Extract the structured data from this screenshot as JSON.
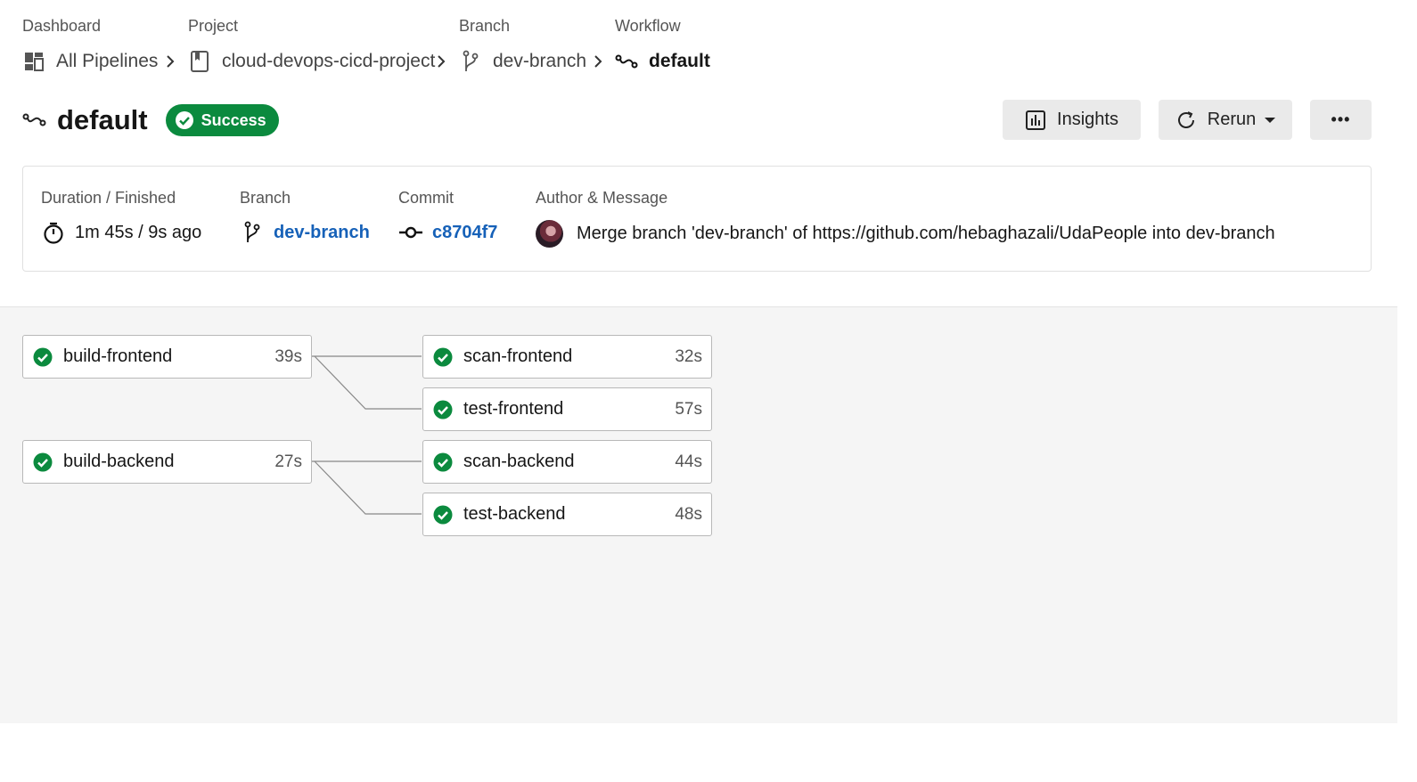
{
  "breadcrumb": {
    "dashboard": {
      "label": "Dashboard",
      "value": "All Pipelines"
    },
    "project": {
      "label": "Project",
      "value": "cloud-devops-cicd-project"
    },
    "branch": {
      "label": "Branch",
      "value": "dev-branch"
    },
    "workflow": {
      "label": "Workflow",
      "value": "default"
    }
  },
  "header": {
    "title": "default",
    "status": "Success",
    "status_color": "#0b8a3e",
    "insights_label": "Insights",
    "rerun_label": "Rerun",
    "more_label": "•••"
  },
  "summary": {
    "duration": {
      "label": "Duration / Finished",
      "value": "1m 45s / 9s ago"
    },
    "branch": {
      "label": "Branch",
      "value": "dev-branch"
    },
    "commit": {
      "label": "Commit",
      "value": "c8704f7"
    },
    "author": {
      "label": "Author & Message",
      "message": "Merge branch 'dev-branch' of https://github.com/hebaghazali/UdaPeople into dev-branch"
    }
  },
  "jobs": {
    "build_frontend": {
      "name": "build-frontend",
      "duration": "39s"
    },
    "scan_frontend": {
      "name": "scan-frontend",
      "duration": "32s"
    },
    "test_frontend": {
      "name": "test-frontend",
      "duration": "57s"
    },
    "build_backend": {
      "name": "build-backend",
      "duration": "27s"
    },
    "scan_backend": {
      "name": "scan-backend",
      "duration": "44s"
    },
    "test_backend": {
      "name": "test-backend",
      "duration": "48s"
    }
  },
  "colors": {
    "success": "#0b8a3e",
    "link": "#1661b8"
  }
}
